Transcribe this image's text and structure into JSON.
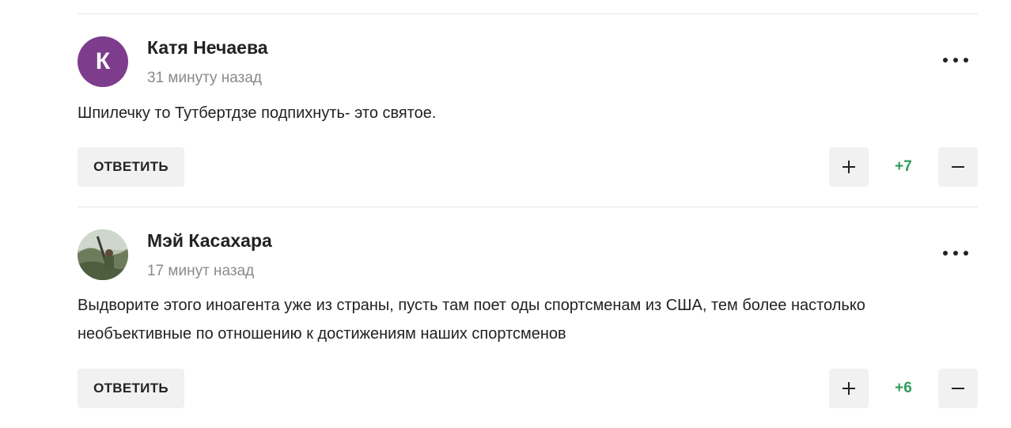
{
  "comments": [
    {
      "avatar_letter": "К",
      "avatar_color": "#7e3d8c",
      "author": "Катя Нечаева",
      "time": "31 минуту назад",
      "text": "Шпилечку то Тутбертдзе подпихнуть- это святое.",
      "reply_label": "ОТВЕТИТЬ",
      "score": "+7"
    },
    {
      "avatar_letter": "",
      "avatar_color": "#6f7f63",
      "author": "Мэй Касахара",
      "time": "17 минут назад",
      "text": "Выдворите этого иноагента уже из страны, пусть там поет оды спортсменам из США, тем более настолько необъективные по отношению к достижениям наших спортсменов",
      "reply_label": "ОТВЕТИТЬ",
      "score": "+6"
    }
  ],
  "colors": {
    "score_positive": "#2e9e5b",
    "button_bg": "#f1f1f1",
    "divider": "#e6e6e6"
  },
  "icons": {
    "more": "more-dots-icon",
    "upvote": "plus-icon",
    "downvote": "minus-icon"
  }
}
